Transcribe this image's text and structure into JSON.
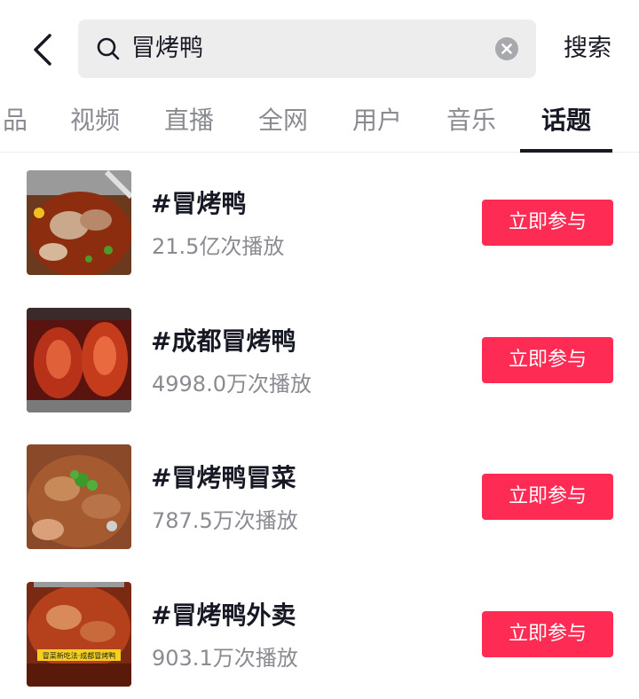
{
  "header": {
    "search_value": "冒烤鸭",
    "search_button": "搜索"
  },
  "tabs": [
    {
      "label": "品"
    },
    {
      "label": "视频"
    },
    {
      "label": "直播"
    },
    {
      "label": "全网"
    },
    {
      "label": "用户"
    },
    {
      "label": "音乐"
    },
    {
      "label": "话题",
      "active": true
    }
  ],
  "topics": [
    {
      "title": "#冒烤鸭",
      "plays": "21.5亿次播放",
      "button": "立即参与"
    },
    {
      "title": "#成都冒烤鸭",
      "plays": "4998.0万次播放",
      "button": "立即参与"
    },
    {
      "title": "#冒烤鸭冒菜",
      "plays": "787.5万次播放",
      "button": "立即参与"
    },
    {
      "title": "#冒烤鸭外卖",
      "plays": "903.1万次播放",
      "button": "立即参与"
    }
  ],
  "thumb_captions": {
    "topic_4": "冒菜新吃法·成都冒烤鸭"
  },
  "colors": {
    "accent": "#fe2c55",
    "text_primary": "#161823",
    "text_secondary": "#8a8b91"
  }
}
